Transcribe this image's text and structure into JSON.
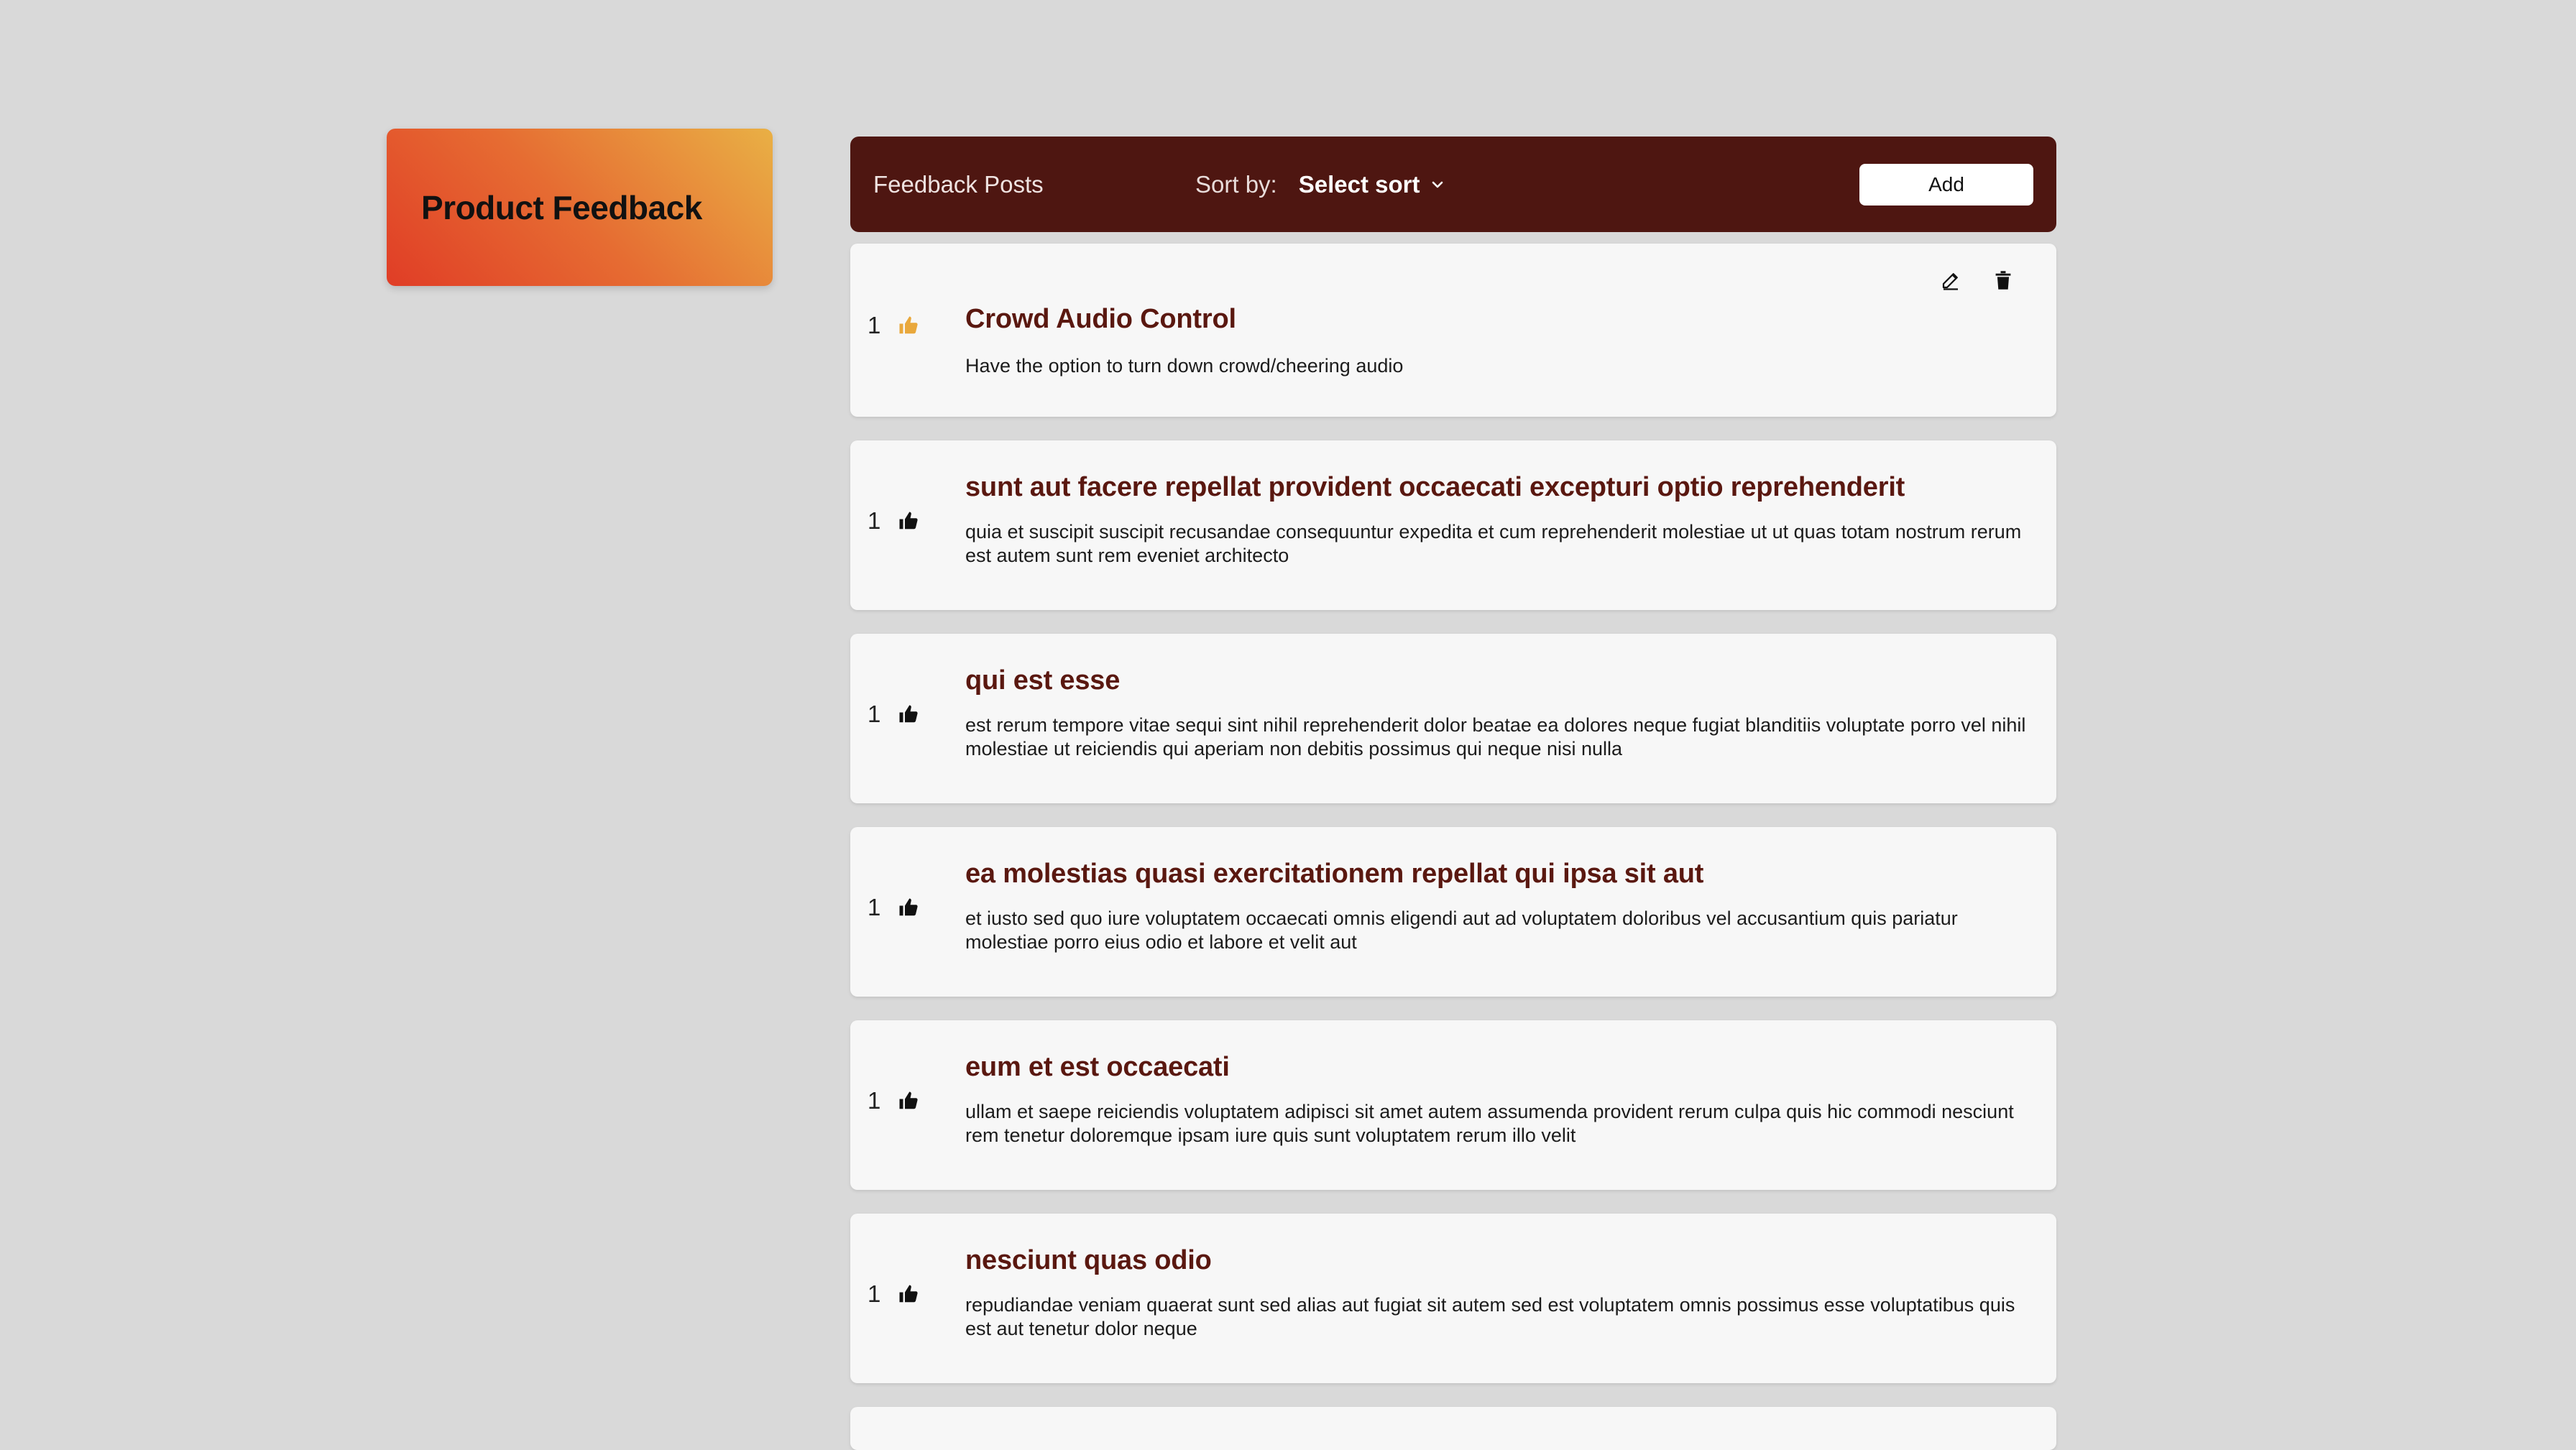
{
  "brand": {
    "title": "Product Feedback"
  },
  "toolbar": {
    "title": "Feedback Posts",
    "sort_label": "Sort by:",
    "sort_value": "Select sort",
    "add_label": "Add"
  },
  "posts": [
    {
      "votes": "1",
      "title": "Crowd Audio Control",
      "body": "Have the option to turn down crowd/cheering audio",
      "upvoted": true
    },
    {
      "votes": "1",
      "title": "sunt aut facere repellat provident occaecati excepturi optio reprehenderit",
      "body": "quia et suscipit suscipit recusandae consequuntur expedita et cum reprehenderit molestiae ut ut quas totam nostrum rerum est autem sunt rem eveniet architecto",
      "upvoted": false
    },
    {
      "votes": "1",
      "title": "qui est esse",
      "body": "est rerum tempore vitae sequi sint nihil reprehenderit dolor beatae ea dolores neque fugiat blanditiis voluptate porro vel nihil molestiae ut reiciendis qui aperiam non debitis possimus qui neque nisi nulla",
      "upvoted": false
    },
    {
      "votes": "1",
      "title": "ea molestias quasi exercitationem repellat qui ipsa sit aut",
      "body": "et iusto sed quo iure voluptatem occaecati omnis eligendi aut ad voluptatem doloribus vel accusantium quis pariatur molestiae porro eius odio et labore et velit aut",
      "upvoted": false
    },
    {
      "votes": "1",
      "title": "eum et est occaecati",
      "body": "ullam et saepe reiciendis voluptatem adipisci sit amet autem assumenda provident rerum culpa quis hic commodi nesciunt rem tenetur doloremque ipsam iure quis sunt voluptatem rerum illo velit",
      "upvoted": false
    },
    {
      "votes": "1",
      "title": "nesciunt quas odio",
      "body": "repudiandae veniam quaerat sunt sed alias aut fugiat sit autem sed est voluptatem omnis possimus esse voluptatibus quis est aut tenetur dolor neque",
      "upvoted": false
    }
  ],
  "icons": {
    "upvote": "thumbs-up-icon",
    "edit": "pencil-icon",
    "delete": "trash-icon",
    "sort_chevron": "chevron-down-icon"
  },
  "colors": {
    "background": "#d9d9d9",
    "toolbar": "#4e1611",
    "post_title": "#5a1810",
    "upvoted": "#e9a83c",
    "brand_gradient": [
      "#e03d26",
      "#e9b045"
    ]
  }
}
